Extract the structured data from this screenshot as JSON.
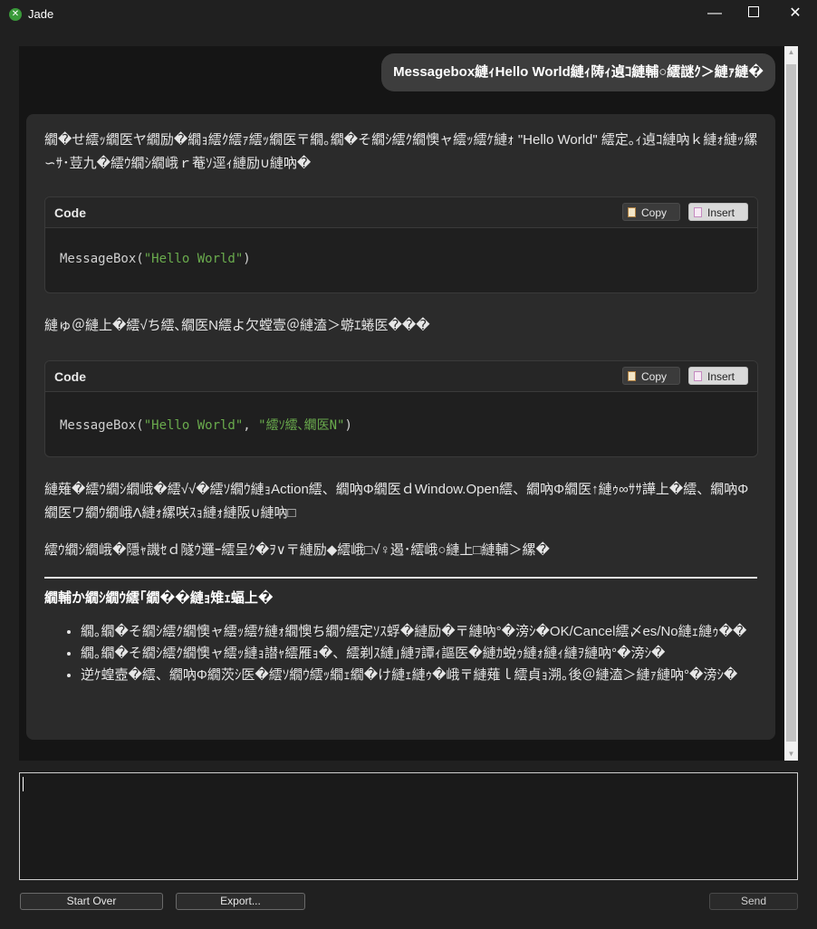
{
  "window": {
    "title": "Jade",
    "app_icon": "jade-logo-icon",
    "minimize_glyph": "—",
    "close_glyph": "✕"
  },
  "conversation": {
    "user_message": "Messagebox縺ｨHello World縺ｨ陦ｨ遉ｺ縺輔○繧謎ｸ＞縺ｧ縺�",
    "assistant": {
      "intro": "繝�せ繧ｯ繝医ヤ繝励�繝ｮ繧ｸ繧ｧ繧ｯ繝医〒繝｡繝�そ繝ｼ繧ｸ繝懊ャ繧ｯ繧ｹ縺ｫ \"Hello World\" 繧定｡ｨ遉ｺ縺吶ｋ縺ｫ縺ｯ縲∽ｻ･荳九�繧ｳ繝ｼ繝峨ｒ菴ｿ逕ｨ縺励∪縺吶�",
      "code_blocks": [
        {
          "label": "Code",
          "copy_label": "Copy",
          "insert_label": "Insert",
          "code_prefix": "MessageBox(",
          "code_string": "\"Hello World\"",
          "code_string2": "",
          "code_suffix": ")"
        },
        {
          "label": "Code",
          "copy_label": "Copy",
          "insert_label": "Insert",
          "code_prefix": "MessageBox(",
          "code_string": "\"Hello World\"",
          "code_sep": ", ",
          "code_string2": "\"繧ｿ繧､繝医Ν\"",
          "code_suffix": ")"
        }
      ],
      "para_title": "縺ゅ＠縺上�繧√ち繧､繝医Ν繧よ欠螳壹＠縺溘＞蝣ｴ蜷医���",
      "para_action": "縺薙�繧ｳ繝ｼ繝峨�繧√√�繧ｿ繝ｳ縺ｮAction繧、繝吶Φ繝医ｄWindow.Open繧、繝吶Φ繝医↑縺ｩ∞ｻｻ譁上�繧、繝吶Φ繝医ワ繝ｳ繝峨Λ縺ｫ縲咲ｽｮ縺ｫ縺阪∪縺吶□",
      "para_run": "繧ｳ繝ｼ繝峨�隱ｬ譏ｾｄ隧ｳ邏ｰ繧呈ｸ�ｦ∨〒縺励◆繧峨□√♀遏･繧峨○縺上□縺輔＞縲�",
      "heading": "繝輔か繝ｼ繝ｳ繧｢繝��縺ｮ雉ｪ蝠上�",
      "bullets": [
        "繝｡繝�そ繝ｼ繧ｸ繝懊ャ繧ｯ繧ｹ縺ｫ繝懊ち繝ｳ繧定ｿｽ蜉�縺励�〒縺吶°�滂ｼ�OK/Cancel繧〆es/No縺ｪ縺ｩ��",
        "繝｡繝�そ繝ｼ繧ｸ繝懊ャ繧ｯ縺ｮ譛ｬ繧雁ｮ�、繧剃ｽ縺｣縺ｦ譚ｨ謳医�縺ｶ蛻ｩ縺ｫ縺ｨ縺ｦ縺吶°�滂ｼ�",
        "逆ｹ蝗壼�繧、繝吶Φ繝茨ｼ医�繧ｿ繝ｳ繧ｯ繝ｪ繝�け縺ｪ縺ｩ�峨〒縺薙ｌ繧貞ｮ溯｡後＠縺溘＞縺ｧ縺吶°�滂ｼ�"
      ]
    }
  },
  "input": {
    "value": "",
    "placeholder": ""
  },
  "buttons": {
    "start_over": "Start Over",
    "export": "Export...",
    "send": "Send"
  }
}
